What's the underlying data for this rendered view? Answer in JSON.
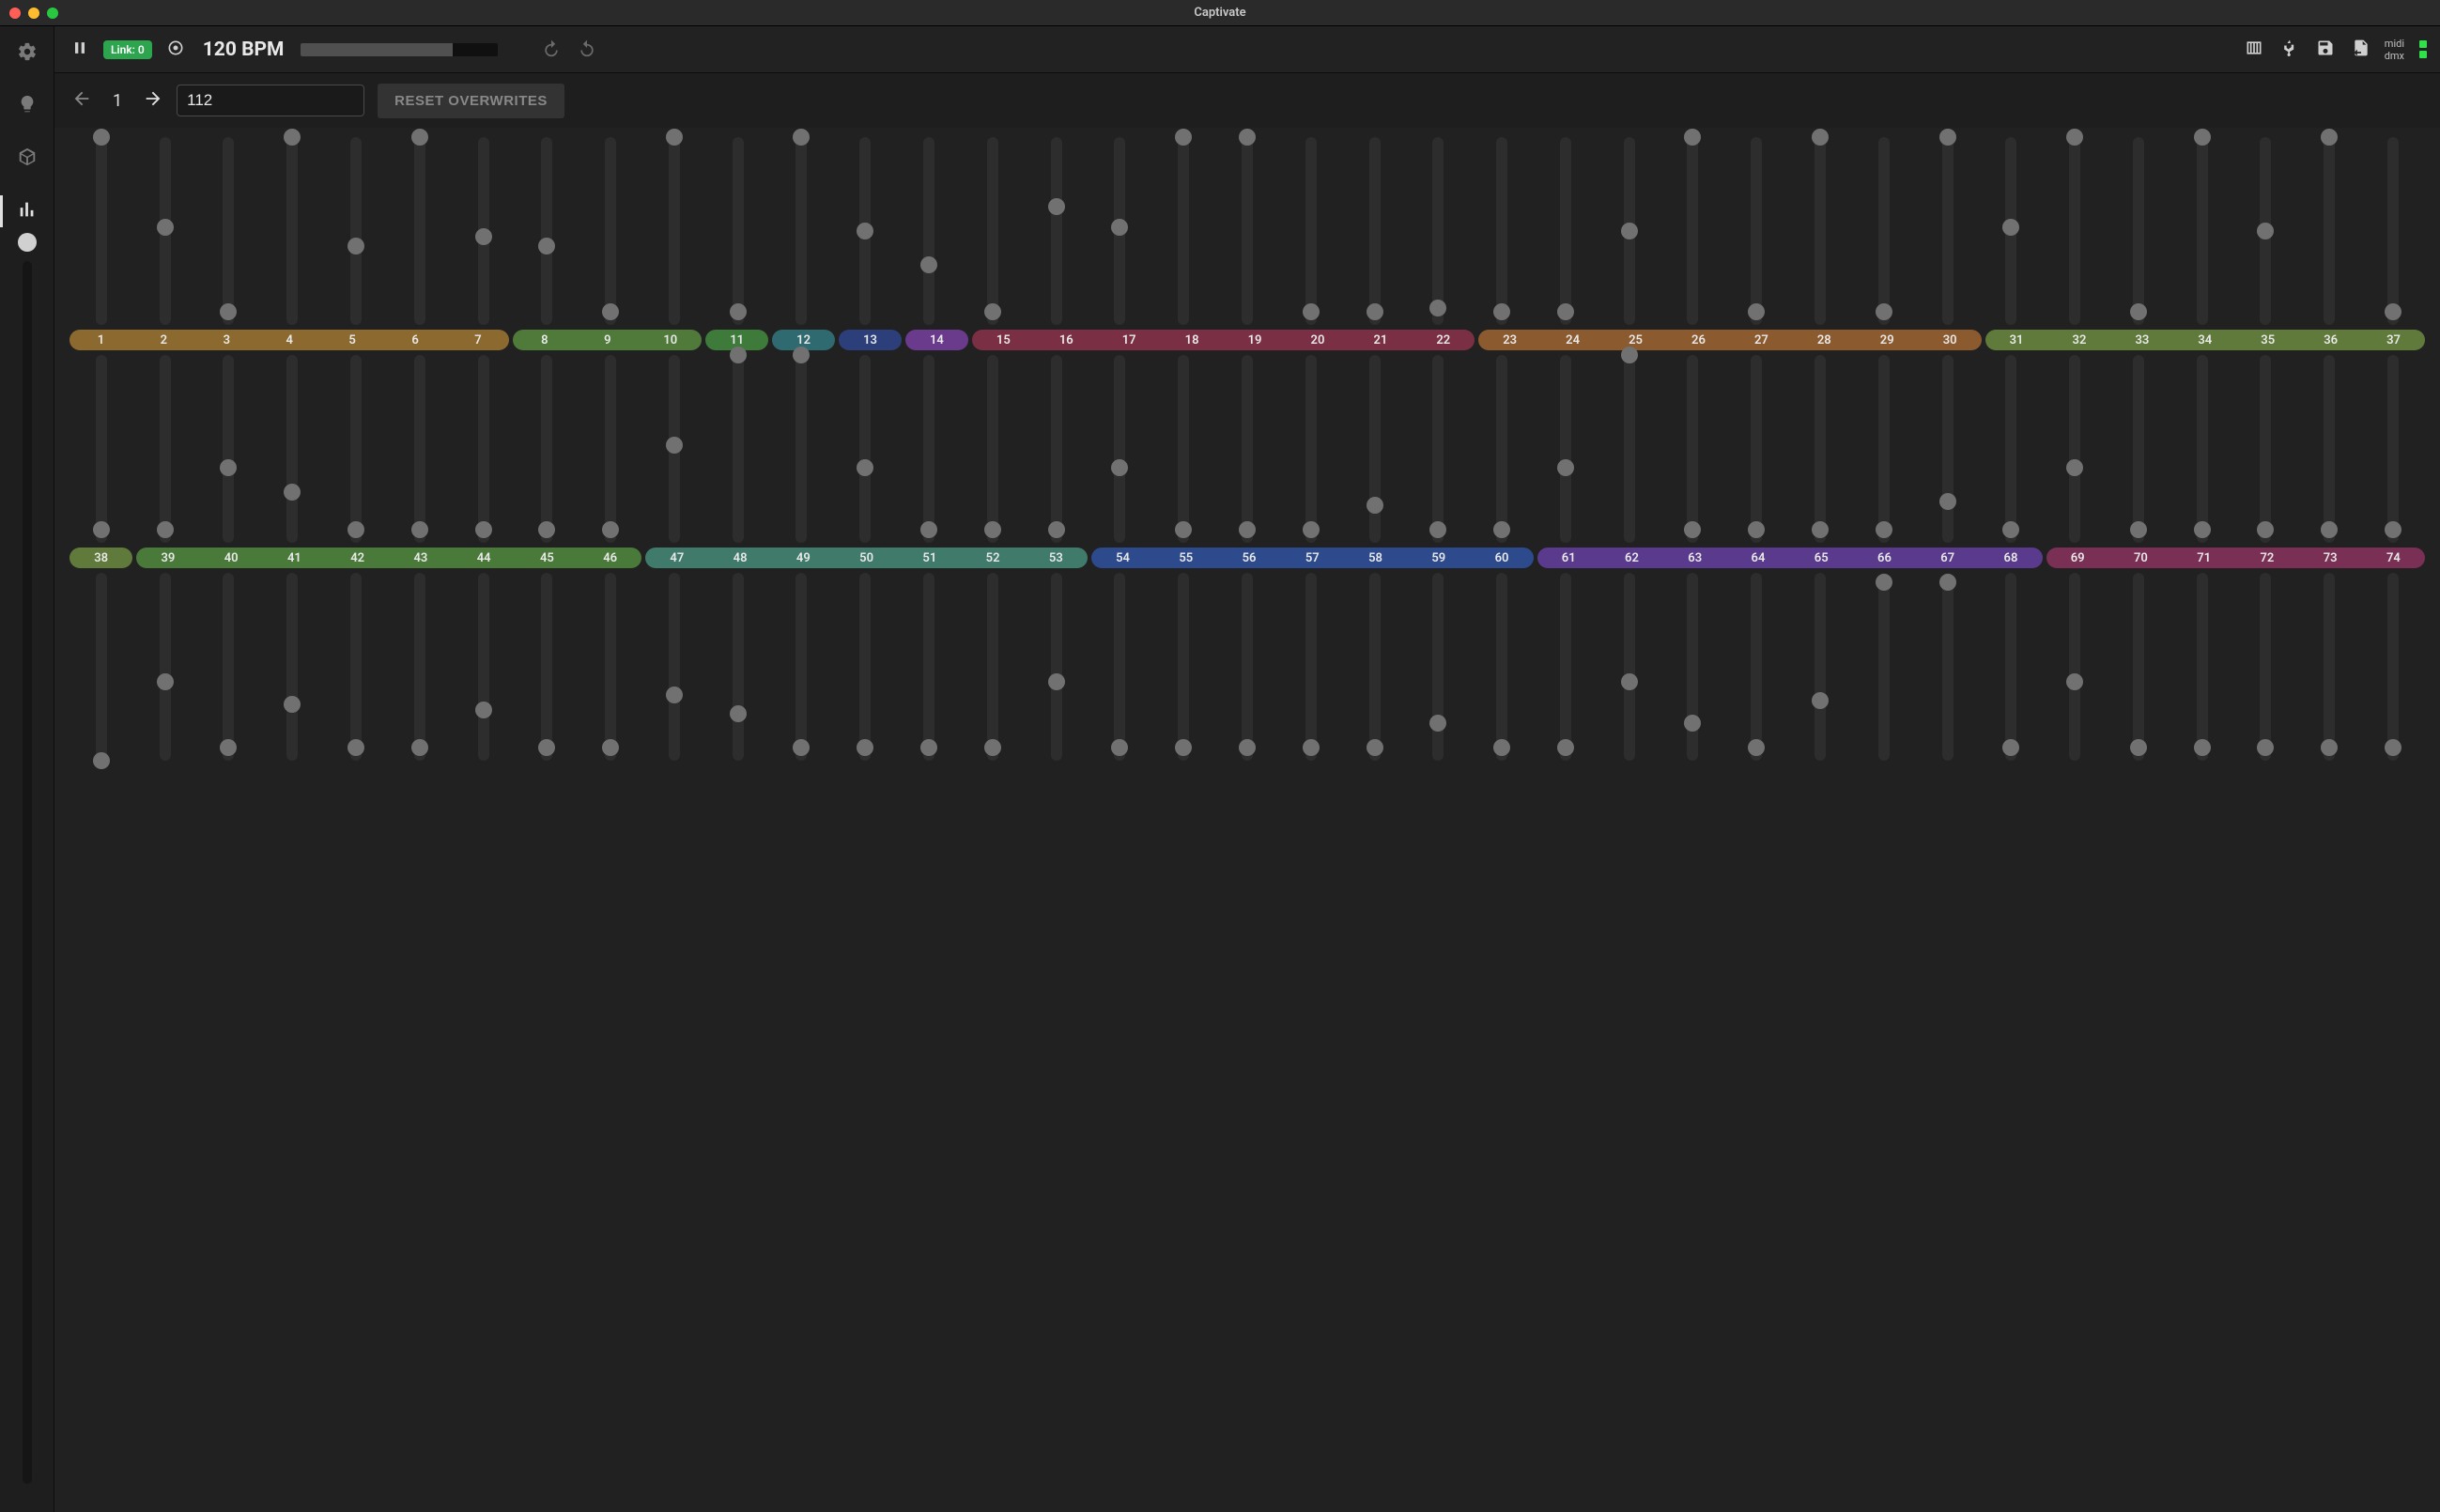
{
  "window": {
    "title": "Captivate"
  },
  "sidebar": {
    "items": [
      {
        "name": "gear",
        "active": false
      },
      {
        "name": "bulb",
        "active": false
      },
      {
        "name": "cube",
        "active": false
      },
      {
        "name": "bars",
        "active": true
      }
    ],
    "master_value": 1.0
  },
  "topbar": {
    "link_label": "Link: 0",
    "bpm_label": "120 BPM",
    "progress": 0.77,
    "status": {
      "midi": "midi",
      "dmx": "dmx"
    }
  },
  "subbar": {
    "page": "1",
    "input_value": "112",
    "reset_label": "RESET OVERWRITES"
  },
  "colors": {
    "brown": "#8c6a2f",
    "olive": "#4f7a3a",
    "green": "#3e7a3a",
    "teal": "#2f6a70",
    "navy": "#2c3f7a",
    "purple": "#6a3a8c",
    "maroon": "#7a2f44",
    "brown2": "#8c5a2f",
    "olive2": "#5f7a3a",
    "green2": "#4a7a3a",
    "teal2": "#3f7a6a",
    "blue": "#2c4a8c",
    "violet": "#5a3a8c",
    "wine": "#7a2f55"
  },
  "rows": [
    {
      "sliders": [
        1.0,
        0.52,
        0.07,
        1.0,
        0.42,
        1.0,
        0.47,
        0.42,
        0.07,
        1.0,
        0.07,
        1.0,
        0.5,
        0.32,
        0.07,
        0.63,
        0.52,
        1.0,
        1.0,
        0.07,
        0.07,
        0.09,
        0.07,
        0.07,
        0.5,
        1.0,
        0.07,
        1.0,
        0.07,
        1.0,
        0.52,
        1.0,
        0.07,
        1.0,
        0.5,
        1.0,
        0.07
      ],
      "groups": [
        {
          "color": "brown",
          "start": 1,
          "end": 7
        },
        {
          "color": "olive",
          "start": 8,
          "end": 10
        },
        {
          "color": "green",
          "start": 11,
          "end": 11
        },
        {
          "color": "teal",
          "start": 12,
          "end": 12
        },
        {
          "color": "navy",
          "start": 13,
          "end": 13
        },
        {
          "color": "purple",
          "start": 14,
          "end": 14
        },
        {
          "color": "maroon",
          "start": 15,
          "end": 22
        },
        {
          "color": "brown2",
          "start": 23,
          "end": 30
        },
        {
          "color": "olive2",
          "start": 31,
          "end": 37
        }
      ]
    },
    {
      "sliders": [
        0.07,
        0.07,
        0.4,
        0.27,
        0.07,
        0.07,
        0.07,
        0.07,
        0.07,
        0.52,
        1.0,
        1.0,
        0.4,
        0.07,
        0.07,
        0.07,
        0.4,
        0.07,
        0.07,
        0.07,
        0.2,
        0.07,
        0.07,
        0.4,
        1.0,
        0.07,
        0.07,
        0.07,
        0.07,
        0.22,
        0.07,
        0.4,
        0.07,
        0.07,
        0.07,
        0.07,
        0.07
      ],
      "groups": [
        {
          "color": "olive2",
          "start": 38,
          "end": 38
        },
        {
          "color": "green2",
          "start": 39,
          "end": 46
        },
        {
          "color": "teal2",
          "start": 47,
          "end": 53
        },
        {
          "color": "blue",
          "start": 54,
          "end": 60
        },
        {
          "color": "violet",
          "start": 61,
          "end": 68
        },
        {
          "color": "wine",
          "start": 69,
          "end": 74
        }
      ]
    },
    {
      "sliders": [
        0.0,
        0.42,
        0.07,
        0.3,
        0.07,
        0.07,
        0.27,
        0.07,
        0.07,
        0.35,
        0.25,
        0.07,
        0.07,
        0.07,
        0.07,
        0.42,
        0.07,
        0.07,
        0.07,
        0.07,
        0.07,
        0.2,
        0.07,
        0.07,
        0.42,
        0.2,
        0.07,
        0.32,
        0.95,
        0.95,
        0.07,
        0.42,
        0.07,
        0.07,
        0.07,
        0.07,
        0.07
      ],
      "groups": []
    }
  ]
}
